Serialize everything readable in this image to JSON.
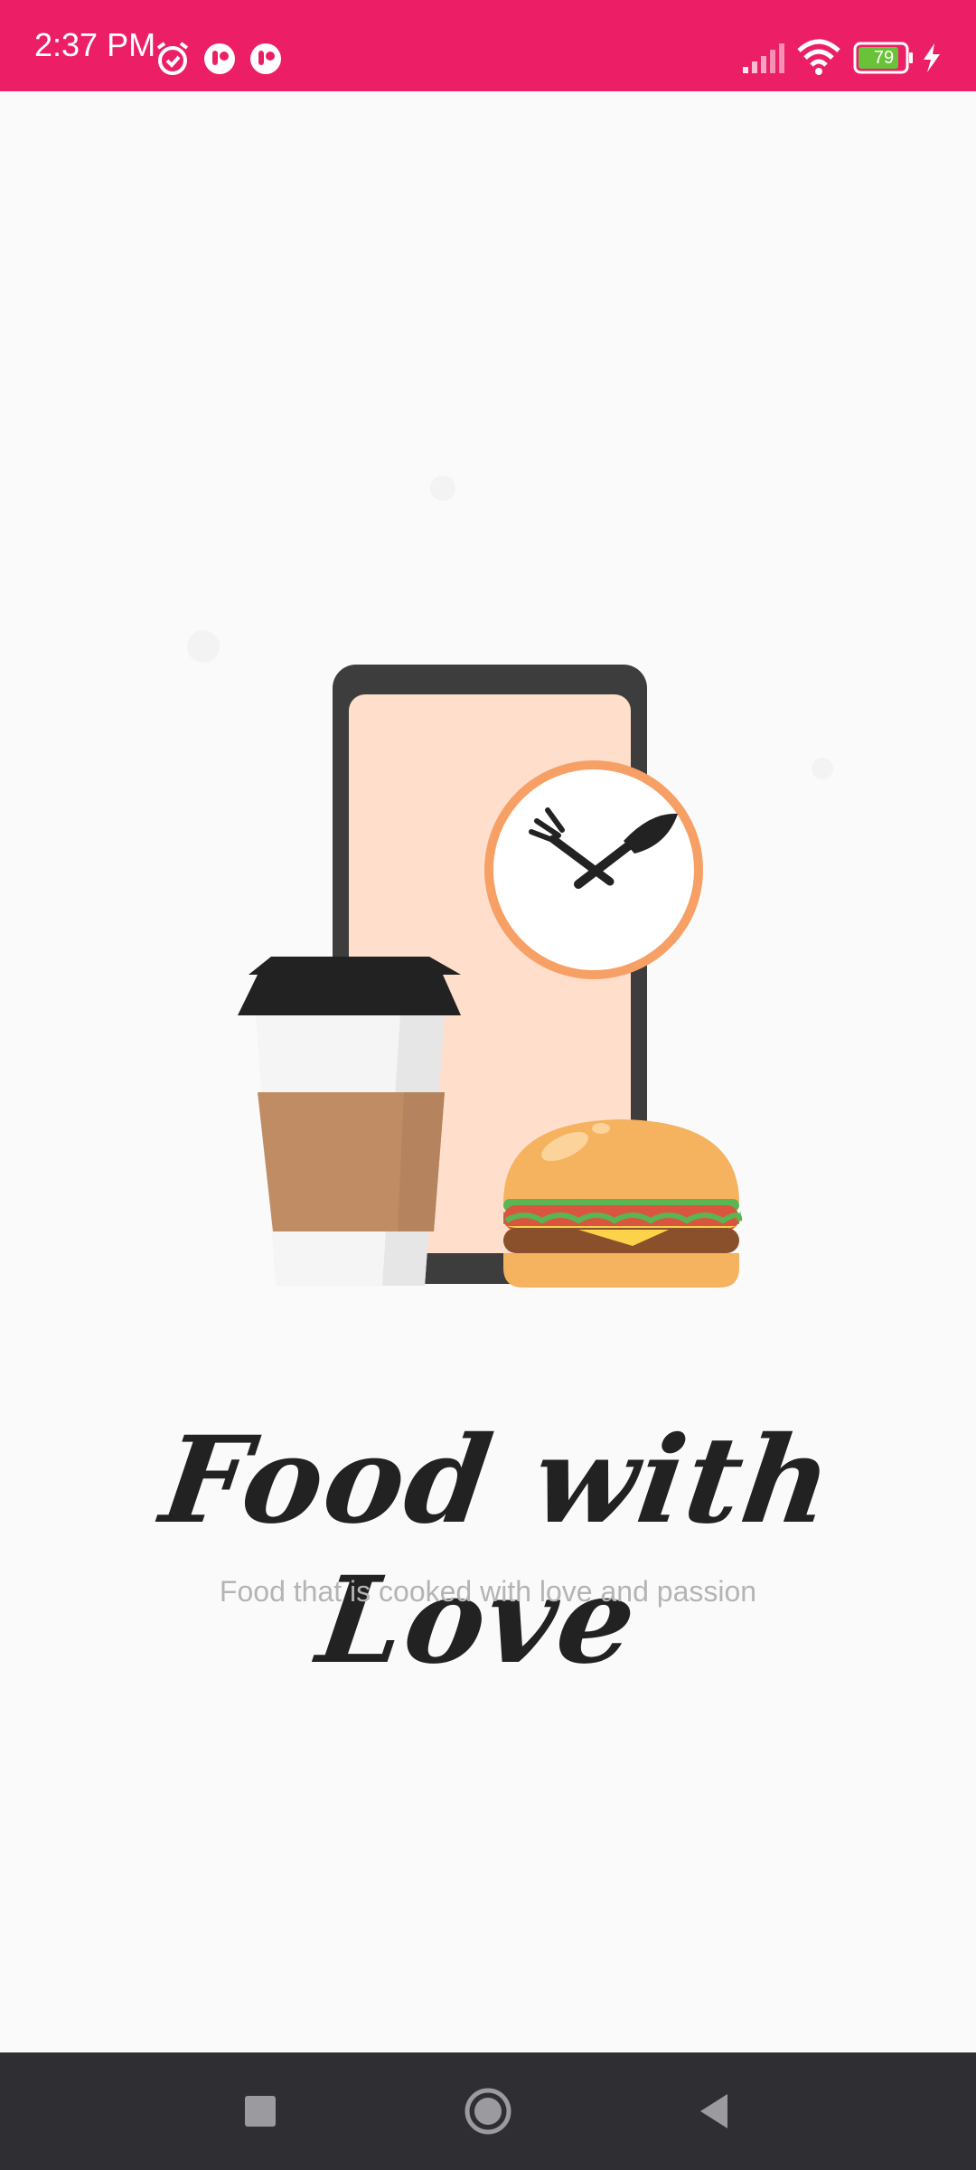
{
  "status_bar": {
    "time": "2:37 PM",
    "battery_level": "79",
    "icons": [
      "alarm-icon",
      "app-notification-icon",
      "app-notification-icon",
      "signal-icon",
      "wifi-icon",
      "battery-icon",
      "charging-icon"
    ]
  },
  "splash": {
    "illustration": "food-delivery-illustration",
    "title": "Food with Love",
    "subtitle": "Food that is cooked with love and passion"
  },
  "nav_bar": {
    "buttons": [
      "recents-button",
      "home-button",
      "back-button"
    ]
  },
  "colors": {
    "status_bar": "#ec1f66",
    "background": "#fafafa",
    "phone_frame": "#3d3d3d",
    "phone_screen": "#ffdfcc",
    "clock_ring": "#f7a065",
    "burger_bun": "#f5b25f",
    "coffee": "#c08c64",
    "nav_bar": "#2e2e33"
  }
}
